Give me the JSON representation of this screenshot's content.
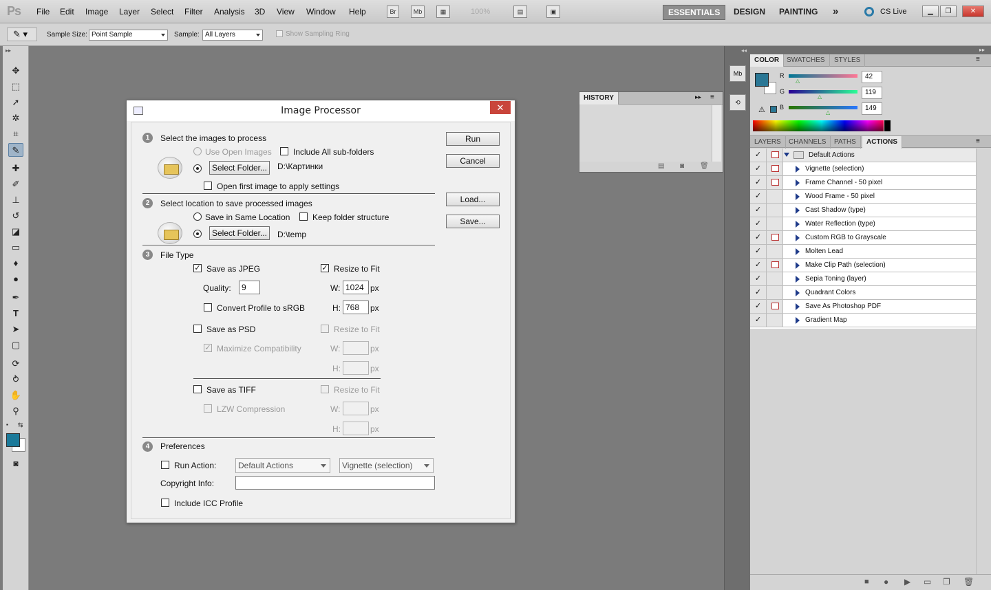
{
  "app": {
    "logo": "Ps",
    "zoom": "100%",
    "cs_live": "CS Live"
  },
  "menu": [
    "File",
    "Edit",
    "Image",
    "Layer",
    "Select",
    "Filter",
    "Analysis",
    "3D",
    "View",
    "Window",
    "Help"
  ],
  "app_buttons": {
    "bridge": "Br",
    "mini_bridge": "Mb"
  },
  "workspaces": {
    "essentials": "ESSENTIALS",
    "design": "DESIGN",
    "painting": "PAINTING",
    "more": "»"
  },
  "options": {
    "sample_size_label": "Sample Size:",
    "sample_size_value": "Point Sample",
    "sample_label": "Sample:",
    "sample_value": "All Layers",
    "show_ring": "Show Sampling Ring"
  },
  "dialog": {
    "title": "Image Processor",
    "close": "✕",
    "s1": {
      "num": "1",
      "title": "Select the images to process",
      "use_open": "Use Open Images",
      "include_sub": "Include All sub-folders",
      "select_folder": "Select Folder...",
      "folder_path": "D:\\Картинки",
      "open_first": "Open first image to apply settings"
    },
    "s2": {
      "num": "2",
      "title": "Select location to save processed images",
      "same_location": "Save in Same Location",
      "keep_structure": "Keep folder structure",
      "select_folder": "Select Folder...",
      "folder_path": "D:\\temp"
    },
    "s3": {
      "num": "3",
      "title": "File Type",
      "jpeg": "Save as JPEG",
      "resize": "Resize to Fit",
      "quality_label": "Quality:",
      "quality": "9",
      "w_label": "W:",
      "w_value": "1024",
      "h_label": "H:",
      "h_value": "768",
      "px": "px",
      "convert": "Convert Profile to sRGB",
      "psd": "Save as PSD",
      "maximize": "Maximize Compatibility",
      "tiff": "Save as TIFF",
      "lzw": "LZW Compression"
    },
    "s4": {
      "num": "4",
      "title": "Preferences",
      "run_action": "Run Action:",
      "action_set": "Default Actions",
      "action": "Vignette (selection)",
      "copyright": "Copyright Info:",
      "icc": "Include ICC Profile"
    },
    "buttons": {
      "run": "Run",
      "cancel": "Cancel",
      "load": "Load...",
      "save": "Save..."
    }
  },
  "history": {
    "title": "HISTORY"
  },
  "color_panel": {
    "tabs": [
      "COLOR",
      "SWATCHES",
      "STYLES"
    ],
    "r_label": "R",
    "r": "42",
    "g_label": "G",
    "g": "119",
    "b_label": "B",
    "b": "149",
    "foreground": "#2a7795"
  },
  "actions_panel": {
    "tabs": [
      "LAYERS",
      "CHANNELS",
      "PATHS",
      "ACTIONS"
    ],
    "set_name": "Default Actions",
    "items": [
      "Vignette (selection)",
      "Frame Channel - 50 pixel",
      "Wood Frame - 50 pixel",
      "Cast Shadow (type)",
      "Water Reflection (type)",
      "Custom RGB to Grayscale",
      "Molten Lead",
      "Make Clip Path (selection)",
      "Sepia Toning (layer)",
      "Quadrant Colors",
      "Save As Photoshop PDF",
      "Gradient Map"
    ]
  }
}
